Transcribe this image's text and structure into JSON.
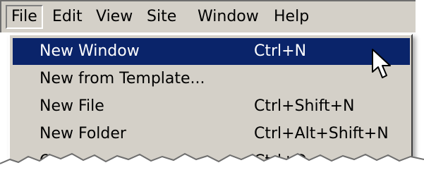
{
  "menubar": {
    "items": [
      {
        "label": "File"
      },
      {
        "label": "Edit"
      },
      {
        "label": "View"
      },
      {
        "label": "Site"
      },
      {
        "label": "Window"
      },
      {
        "label": "Help"
      }
    ]
  },
  "file_menu": {
    "items": [
      {
        "label": "New Window",
        "shortcut": "Ctrl+N"
      },
      {
        "label": "New from Template...",
        "shortcut": ""
      },
      {
        "label": "New File",
        "shortcut": "Ctrl+Shift+N"
      },
      {
        "label": "New Folder",
        "shortcut": "Ctrl+Alt+Shift+N"
      },
      {
        "label": "Open...",
        "shortcut": "Ctrl+O"
      }
    ]
  },
  "colors": {
    "menu_background": "#d4d0c8",
    "highlight_background": "#0a246a",
    "highlight_text": "#ffffff"
  },
  "icons": {
    "cursor": "mouse-pointer-icon"
  }
}
